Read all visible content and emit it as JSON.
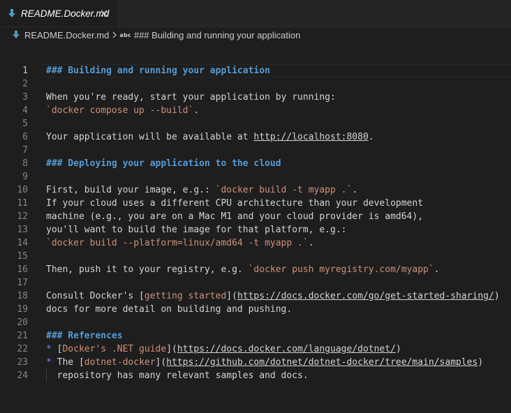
{
  "tab": {
    "label": "README.Docker.md",
    "icon": "download-arrow-icon",
    "close_icon": "close-icon"
  },
  "breadcrumb": {
    "file": "README.Docker.md",
    "separator_icon": "chevron-right-icon",
    "symbol_kind": "abc",
    "symbol": "### Building and running your application"
  },
  "editor": {
    "active_line": 1,
    "lines": [
      {
        "n": "1",
        "segs": [
          {
            "t": "### Building and running your application",
            "c": "h"
          }
        ]
      },
      {
        "n": "2",
        "segs": []
      },
      {
        "n": "3",
        "segs": [
          {
            "t": "When you're ready, start your application by running:",
            "c": "p"
          }
        ]
      },
      {
        "n": "4",
        "segs": [
          {
            "t": "`docker compose up --build`",
            "c": "ic"
          },
          {
            "t": ".",
            "c": "p"
          }
        ]
      },
      {
        "n": "5",
        "segs": []
      },
      {
        "n": "6",
        "segs": [
          {
            "t": "Your application will be available at ",
            "c": "p"
          },
          {
            "t": "http://localhost:8080",
            "c": "url"
          },
          {
            "t": ".",
            "c": "p"
          }
        ]
      },
      {
        "n": "7",
        "segs": []
      },
      {
        "n": "8",
        "segs": [
          {
            "t": "### Deploying your application to the cloud",
            "c": "h"
          }
        ]
      },
      {
        "n": "9",
        "segs": []
      },
      {
        "n": "10",
        "segs": [
          {
            "t": "First, build your image, e.g.: ",
            "c": "p"
          },
          {
            "t": "`docker build -t myapp .`",
            "c": "ic"
          },
          {
            "t": ".",
            "c": "p"
          }
        ]
      },
      {
        "n": "11",
        "segs": [
          {
            "t": "If your cloud uses a different CPU architecture than your development",
            "c": "p"
          }
        ]
      },
      {
        "n": "12",
        "segs": [
          {
            "t": "machine (e.g., you are on a Mac M1 and your cloud provider is amd64),",
            "c": "p"
          }
        ]
      },
      {
        "n": "13",
        "segs": [
          {
            "t": "you'll want to build the image for that platform, e.g.:",
            "c": "p"
          }
        ]
      },
      {
        "n": "14",
        "segs": [
          {
            "t": "`docker build --platform=linux/amd64 -t myapp .`",
            "c": "ic"
          },
          {
            "t": ".",
            "c": "p"
          }
        ]
      },
      {
        "n": "15",
        "segs": []
      },
      {
        "n": "16",
        "segs": [
          {
            "t": "Then, push it to your registry, e.g. ",
            "c": "p"
          },
          {
            "t": "`docker push myregistry.com/myapp`",
            "c": "ic"
          },
          {
            "t": ".",
            "c": "p"
          }
        ]
      },
      {
        "n": "17",
        "segs": []
      },
      {
        "n": "18",
        "segs": [
          {
            "t": "Consult Docker's [",
            "c": "p"
          },
          {
            "t": "getting started",
            "c": "lt"
          },
          {
            "t": "](",
            "c": "p"
          },
          {
            "t": "https://docs.docker.com/go/get-started-sharing/",
            "c": "url"
          },
          {
            "t": ")",
            "c": "p"
          }
        ]
      },
      {
        "n": "19",
        "segs": [
          {
            "t": "docs for more detail on building and pushing.",
            "c": "p"
          }
        ]
      },
      {
        "n": "20",
        "segs": []
      },
      {
        "n": "21",
        "segs": [
          {
            "t": "### References",
            "c": "h"
          }
        ]
      },
      {
        "n": "22",
        "segs": [
          {
            "t": "*",
            "c": "bullet"
          },
          {
            "t": " [",
            "c": "p"
          },
          {
            "t": "Docker's .NET guide",
            "c": "lt"
          },
          {
            "t": "](",
            "c": "p"
          },
          {
            "t": "https://docs.docker.com/language/dotnet/",
            "c": "url"
          },
          {
            "t": ")",
            "c": "p"
          }
        ]
      },
      {
        "n": "23",
        "segs": [
          {
            "t": "*",
            "c": "bullet"
          },
          {
            "t": " The [",
            "c": "p"
          },
          {
            "t": "dotnet-docker",
            "c": "lt"
          },
          {
            "t": "](",
            "c": "p"
          },
          {
            "t": "https://github.com/dotnet/dotnet-docker/tree/main/samples",
            "c": "url"
          },
          {
            "t": ")",
            "c": "p"
          }
        ]
      },
      {
        "n": "24",
        "guide": true,
        "segs": [
          {
            "t": "  repository has many relevant samples and docs.",
            "c": "p"
          }
        ]
      }
    ]
  },
  "colors": {
    "background": "#1e1e1e",
    "heading": "#569cd6",
    "inline_code": "#ce9178",
    "text": "#d4d4d4",
    "line_number": "#858585",
    "tab_bar": "#252526"
  }
}
